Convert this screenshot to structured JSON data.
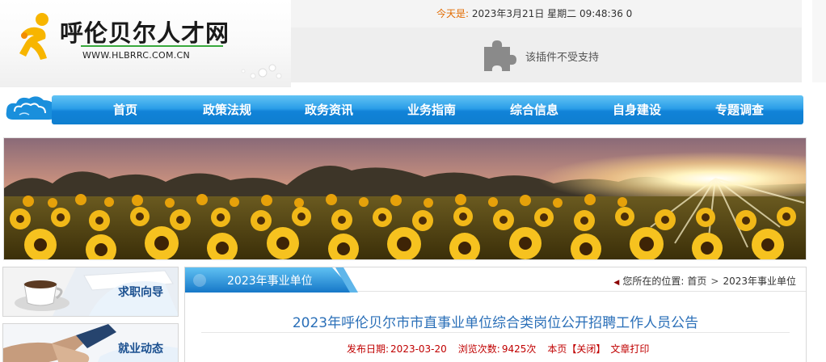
{
  "site": {
    "title": "呼伦贝尔人才网",
    "url": "WWW.HLBRRC.COM.CN"
  },
  "header": {
    "date_label": "今天是:",
    "date_value": "2023年3月21日 星期二 09:48:36 0",
    "plugin_message": "该插件不受支持",
    "plugin_icon": "puzzle-icon"
  },
  "nav": {
    "items": [
      {
        "label": "首页"
      },
      {
        "label": "政策法规"
      },
      {
        "label": "政务资讯"
      },
      {
        "label": "业务指南"
      },
      {
        "label": "综合信息"
      },
      {
        "label": "自身建设"
      },
      {
        "label": "专题调查"
      }
    ]
  },
  "sidebar": {
    "items": [
      {
        "label": "求职向导"
      },
      {
        "label": "就业动态"
      }
    ]
  },
  "content": {
    "section_title": "2023年事业单位",
    "breadcrumb": {
      "prefix": "您所在的位置:",
      "home": "首页",
      "separator": ">",
      "current": "2023年事业单位"
    },
    "article": {
      "title": "2023年呼伦贝尔市市直事业单位综合类岗位公开招聘工作人员公告",
      "publish_date_label": "发布日期:",
      "publish_date": "2023-03-20",
      "views_label": "浏览次数:",
      "views": "9425次",
      "page_label": "本页",
      "close_label": "【关闭】",
      "print_label": "文章打印"
    }
  },
  "colors": {
    "nav_blue": "#1182d8",
    "title_blue": "#2a6fb8",
    "meta_red": "#c00000",
    "date_label_orange": "#e26b00",
    "logo_green": "#39a93d"
  }
}
